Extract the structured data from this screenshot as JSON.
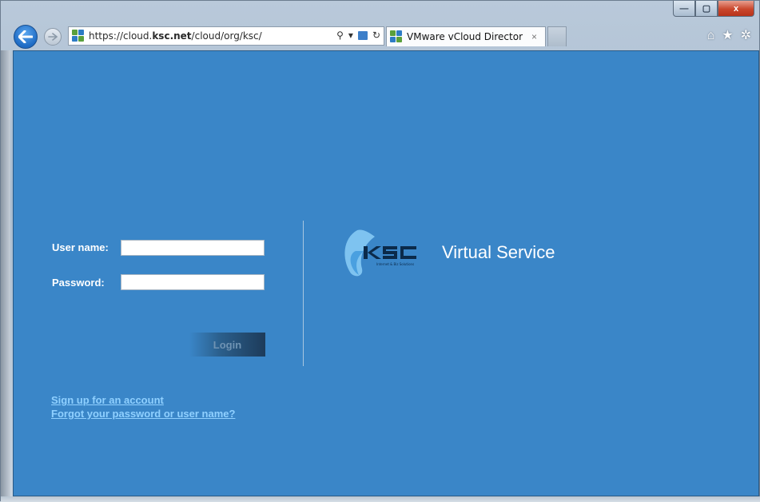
{
  "browser": {
    "address_bar": {
      "url_prefix": "https://cloud.",
      "url_domain": "ksc.net",
      "url_suffix": "/cloud/org/ksc/"
    },
    "tab": {
      "title": "VMware vCloud Director",
      "close_glyph": "×"
    },
    "caption": {
      "min": "—",
      "max": "▢",
      "close": "x"
    },
    "toolbar": {
      "home_glyph": "⌂",
      "star_glyph": "★",
      "gear_glyph": "✲"
    },
    "address_icons": {
      "search": "⚲",
      "dropdown": "▾",
      "refresh": "↻"
    }
  },
  "login": {
    "username_label": "User name:",
    "username_value": "",
    "password_label": "Password:",
    "password_value": "",
    "login_button": "Login",
    "signup_link": "Sign up for an account",
    "forgot_link": "Forgot your password or user name?"
  },
  "brand": {
    "logo_text": "KSC",
    "logo_tagline": "Internet & Biz Solutions",
    "name": "Virtual Service"
  },
  "colors": {
    "content_bg": "#3a86c8",
    "link": "#8fd0ff",
    "accent_blue": "#1e6bc4"
  }
}
